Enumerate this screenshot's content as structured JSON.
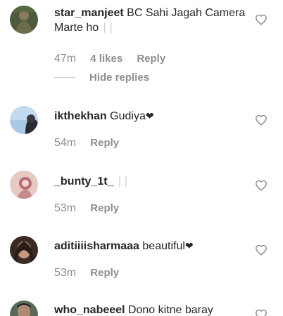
{
  "comments": [
    {
      "username": "star_manjeet",
      "text": "BC Sahi Jagah Camera Marte ho",
      "faded_suffix": "∣∣",
      "time": "47m",
      "likes": "4 likes",
      "reply": "Reply"
    },
    {
      "username": "ikthekhan",
      "text": "Gudiya",
      "emoji": "❤",
      "time": "54m",
      "reply": "Reply"
    },
    {
      "username": "_bunty_1t_",
      "faded_suffix": "∣∣",
      "time": "53m",
      "reply": "Reply"
    },
    {
      "username": "aditiiiisharmaaa",
      "text": "beautiful",
      "emoji": "❤",
      "time": "53m",
      "reply": "Reply"
    },
    {
      "username": "who_nabeeel",
      "text": "Dono kitne baray"
    }
  ],
  "hide_replies": "Hide replies",
  "colors": {
    "text": "#262626",
    "muted": "#8e8e8e",
    "heart_outline": "#8e8e8e"
  },
  "icons": {
    "like": "heart-outline-icon"
  }
}
